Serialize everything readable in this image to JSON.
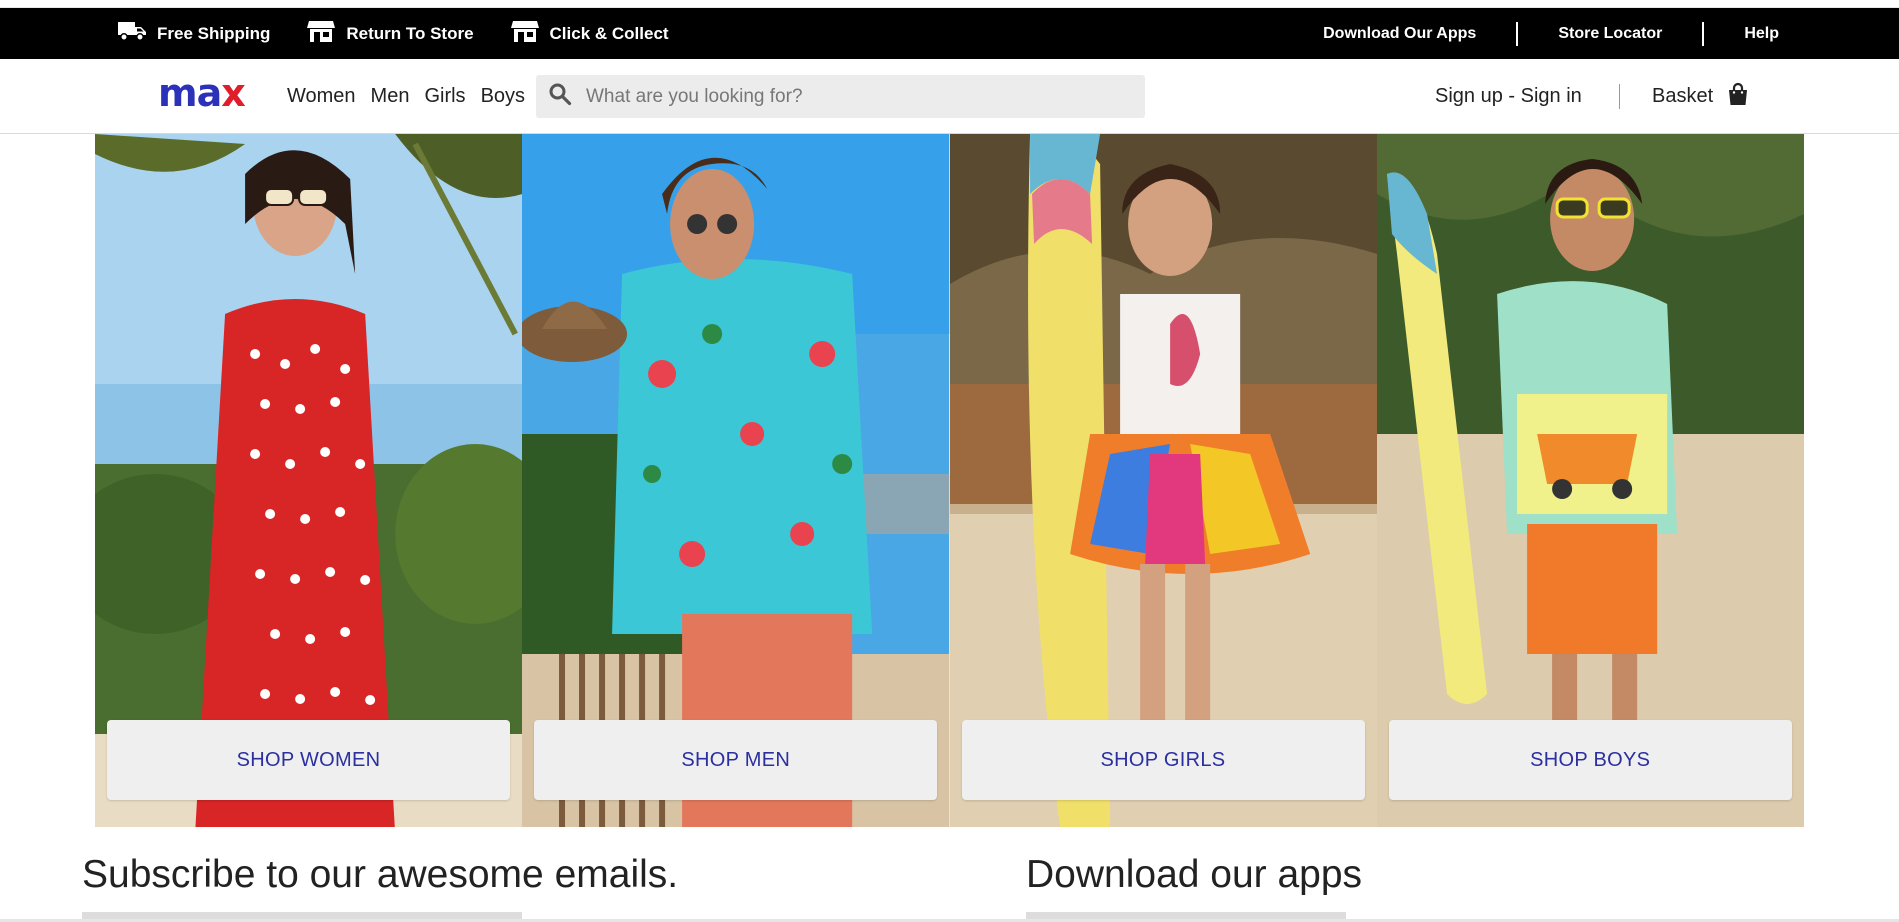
{
  "promo_bar": {
    "items": [
      {
        "label": "Free Shipping",
        "icon": "truck-icon"
      },
      {
        "label": "Return To Store",
        "icon": "store-icon"
      },
      {
        "label": "Click & Collect",
        "icon": "store-icon"
      }
    ],
    "links": [
      "Download Our Apps",
      "Store Locator",
      "Help"
    ]
  },
  "header": {
    "logo": {
      "text": "max"
    },
    "nav": [
      "Women",
      "Men",
      "Girls",
      "Boys"
    ],
    "search": {
      "placeholder": "What are you looking for?",
      "value": "",
      "icon": "search-icon"
    },
    "account": "Sign up - Sign in",
    "basket": {
      "label": "Basket",
      "icon": "shopping-bag-icon"
    }
  },
  "hero": {
    "panels": [
      {
        "button": "SHOP WOMEN"
      },
      {
        "button": "SHOP MEN"
      },
      {
        "button": "SHOP GIRLS"
      },
      {
        "button": "SHOP BOYS"
      }
    ]
  },
  "footer_sections": {
    "subscribe_title": "Subscribe to our awesome emails.",
    "apps_title": "Download our apps"
  },
  "colors": {
    "brand_blue": "#2b31b8",
    "brand_red": "#e01d2b",
    "promo_bg": "#000000",
    "button_text": "#2b2fa0",
    "button_bg": "#efefef"
  }
}
